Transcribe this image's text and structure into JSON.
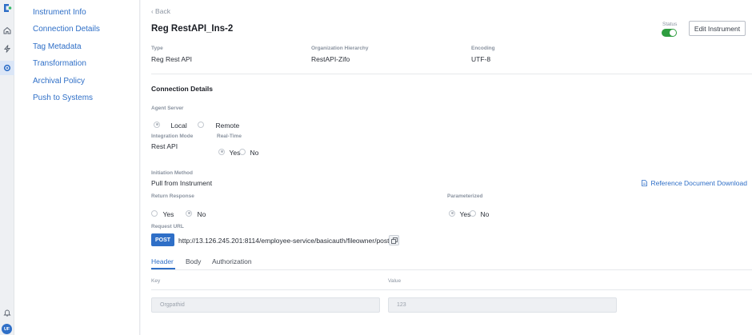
{
  "rail": {
    "icons": [
      "logo-icon",
      "home-icon",
      "bolt-icon",
      "settings-icon",
      "bell-icon"
    ],
    "avatar": "UF"
  },
  "sidebar": {
    "items": [
      {
        "label": "Instrument Info"
      },
      {
        "label": "Connection Details"
      },
      {
        "label": "Tag Metadata"
      },
      {
        "label": "Transformation"
      },
      {
        "label": "Archival Policy"
      },
      {
        "label": "Push to Systems"
      }
    ]
  },
  "header": {
    "back": "Back",
    "title": "Reg RestAPI_Ins-2",
    "status_label": "Status",
    "status_on": true,
    "edit_button": "Edit Instrument"
  },
  "summary": {
    "type_label": "Type",
    "type_value": "Reg Rest API",
    "org_label": "Organization Hierarchy",
    "org_value": "RestAPI-Zifo",
    "encoding_label": "Encoding",
    "encoding_value": "UTF-8"
  },
  "connection": {
    "section_title": "Connection Details",
    "agent_server_label": "Agent Server",
    "agent_options": [
      "Local",
      "Remote"
    ],
    "agent_selected": "Local",
    "integration_mode_label": "Integration Mode",
    "integration_mode_value": "Rest API",
    "realtime_label": "Real-Time",
    "realtime_options": [
      "Yes",
      "No"
    ],
    "realtime_selected": "Yes",
    "initiation_label": "Initiation Method",
    "initiation_value": "Pull from Instrument",
    "reference_link": "Reference Document Download",
    "return_response_label": "Return Response",
    "return_response_options": [
      "Yes",
      "No"
    ],
    "return_response_selected": "No",
    "parameterized_label": "Parameterized",
    "parameterized_options": [
      "Yes",
      "No"
    ],
    "parameterized_selected": "Yes",
    "request_url_label": "Request URL",
    "method": "POST",
    "url": "http://13.126.245.201:8114/employee-service/basicauth/fileowner/post"
  },
  "tabs": [
    {
      "label": "Header",
      "active": true
    },
    {
      "label": "Body",
      "active": false
    },
    {
      "label": "Authorization",
      "active": false
    }
  ],
  "header_table": {
    "key_label": "Key",
    "value_label": "Value",
    "rows": [
      {
        "key": "Orgpathid",
        "value": "123"
      }
    ]
  },
  "colors": {
    "accent": "#2f6fc7",
    "toggle_on": "#2e9d3f"
  }
}
